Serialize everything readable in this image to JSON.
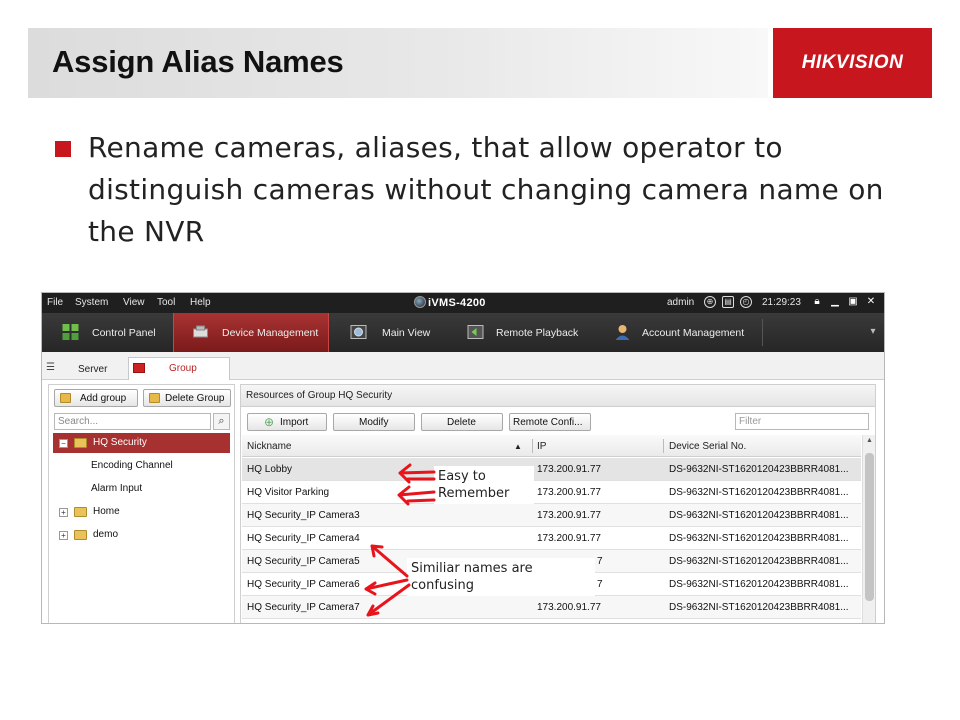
{
  "slide": {
    "title": "Assign Alias Names",
    "logo": "HIKVISION",
    "bullet": "Rename cameras, aliases, that allow operator to distinguish cameras without changing camera name on the NVR",
    "accent_color": "#c8161e"
  },
  "app": {
    "menu": [
      "File",
      "System",
      "View",
      "Tool",
      "Help"
    ],
    "title": "iVMS-4200",
    "user": "admin",
    "time": "21:29:23",
    "window_buttons": [
      "lock-icon",
      "minimize-icon",
      "maximize-icon",
      "close-icon"
    ],
    "tabs": [
      {
        "label": "Control Panel",
        "icon": "grid-icon",
        "active": false
      },
      {
        "label": "Device Management",
        "icon": "device-icon",
        "active": true
      },
      {
        "label": "Main View",
        "icon": "camera-icon",
        "active": false
      },
      {
        "label": "Remote Playback",
        "icon": "playback-icon",
        "active": false
      },
      {
        "label": "Account Management",
        "icon": "user-icon",
        "active": false
      }
    ],
    "subtabs": [
      {
        "label": "Server",
        "active": false
      },
      {
        "label": "Group",
        "active": true
      }
    ],
    "left": {
      "add_group": "Add group",
      "delete_group": "Delete Group",
      "search_placeholder": "Search...",
      "tree": [
        {
          "label": "HQ Security",
          "level": 0,
          "expander": "−",
          "selected": true
        },
        {
          "label": "Encoding Channel",
          "level": 1
        },
        {
          "label": "Alarm Input",
          "level": 1
        },
        {
          "label": "Home",
          "level": 0,
          "expander": "+"
        },
        {
          "label": "demo",
          "level": 0,
          "expander": "+"
        }
      ]
    },
    "right": {
      "title": "Resources of Group HQ Security",
      "buttons": [
        "Import",
        "Modify",
        "Delete",
        "Remote Confi..."
      ],
      "filter_placeholder": "Filter",
      "columns": [
        "Nickname",
        "IP",
        "Device Serial No."
      ],
      "rows": [
        {
          "nickname": "HQ Lobby",
          "ip": "173.200.91.77",
          "serial": "DS-9632NI-ST1620120423BBRR4081..."
        },
        {
          "nickname": "HQ Visitor Parking",
          "ip": "173.200.91.77",
          "serial": "DS-9632NI-ST1620120423BBRR4081..."
        },
        {
          "nickname": "HQ Security_IP Camera3",
          "ip": "173.200.91.77",
          "serial": "DS-9632NI-ST1620120423BBRR4081..."
        },
        {
          "nickname": "HQ Security_IP Camera4",
          "ip": "173.200.91.77",
          "serial": "DS-9632NI-ST1620120423BBRR4081..."
        },
        {
          "nickname": "HQ Security_IP Camera5",
          "ip": "7",
          "serial": "DS-9632NI-ST1620120423BBRR4081..."
        },
        {
          "nickname": "HQ Security_IP Camera6",
          "ip": "7",
          "serial": "DS-9632NI-ST1620120423BBRR4081..."
        },
        {
          "nickname": "HQ Security_IP Camera7",
          "ip": "173.200.91.77",
          "serial": "DS-9632NI-ST1620120423BBRR4081..."
        }
      ]
    },
    "annotations": {
      "easy": "Easy to Remember",
      "similar": "Similiar names are confusing",
      "arrow_color": "#e8141c"
    }
  }
}
